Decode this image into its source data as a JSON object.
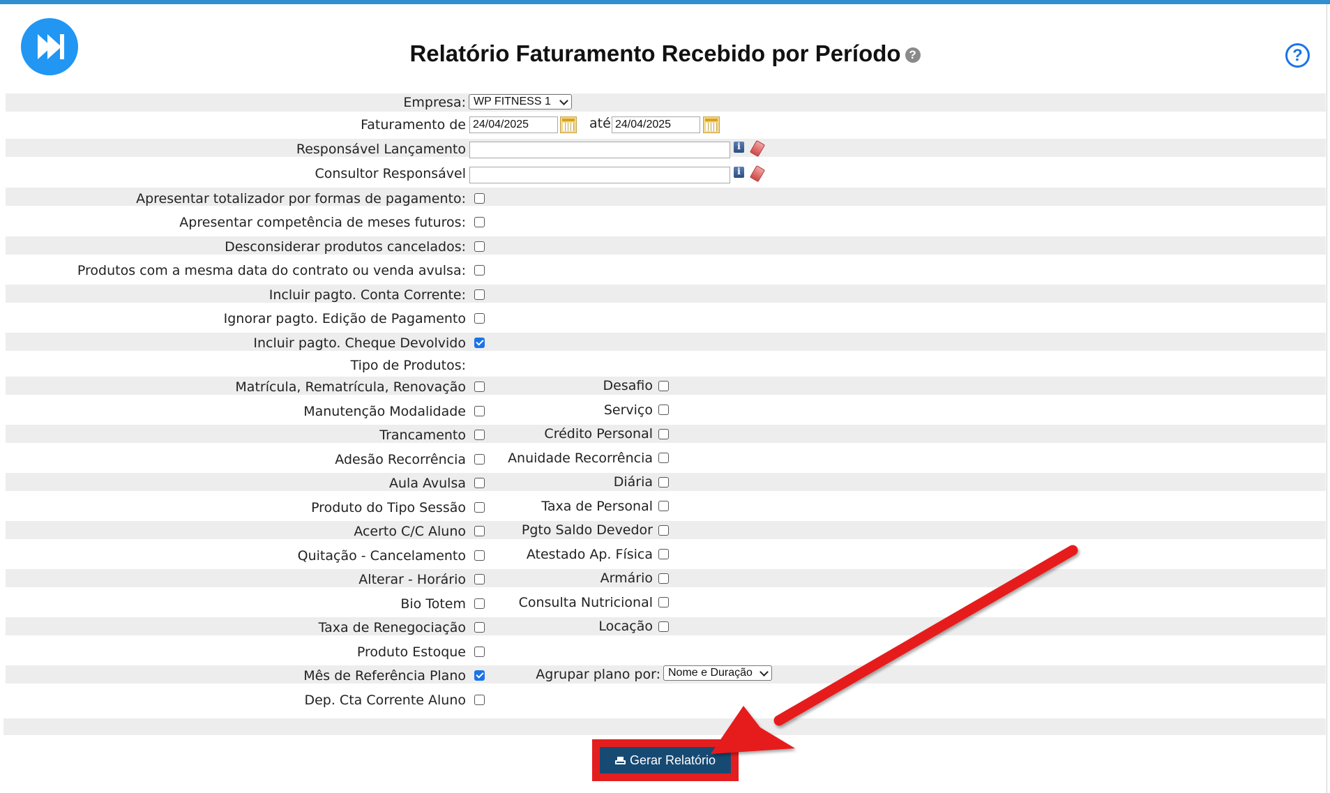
{
  "header": {
    "title": "Relatório Faturamento Recebido por Período",
    "title_help_glyph": "?",
    "help_glyph": "?",
    "logo_icon": "fast-forward-icon"
  },
  "form": {
    "empresa_label": "Empresa:",
    "empresa_value": "WP FITNESS 1",
    "faturamento_label": "Faturamento de",
    "date_from": "24/04/2025",
    "ate_label": "até",
    "date_to": "24/04/2025",
    "responsavel_label": "Responsável Lançamento",
    "consultor_label": "Consultor Responsável",
    "info_glyph": "i"
  },
  "options": [
    {
      "label": "Apresentar totalizador por formas de pagamento:",
      "checked": false
    },
    {
      "label": "Apresentar competência de meses futuros:",
      "checked": false
    },
    {
      "label": "Desconsiderar produtos cancelados:",
      "checked": false
    },
    {
      "label": "Produtos com a mesma data do contrato ou venda avulsa:",
      "checked": false
    },
    {
      "label": "Incluir pagto. Conta Corrente:",
      "checked": false
    },
    {
      "label": "Ignorar pagto. Edição de Pagamento",
      "checked": false
    },
    {
      "label": "Incluir pagto. Cheque Devolvido",
      "checked": true
    }
  ],
  "tipo_produtos_label": "Tipo de Produtos:",
  "product_types": [
    {
      "left": "Matrícula, Rematrícula, Renovação",
      "left_checked": false,
      "right": "Desafio",
      "right_checked": false
    },
    {
      "left": "Manutenção Modalidade",
      "left_checked": false,
      "right": "Serviço",
      "right_checked": false
    },
    {
      "left": "Trancamento",
      "left_checked": false,
      "right": "Crédito Personal",
      "right_checked": false
    },
    {
      "left": "Adesão Recorrência",
      "left_checked": false,
      "right": "Anuidade Recorrência",
      "right_checked": false
    },
    {
      "left": "Aula Avulsa",
      "left_checked": false,
      "right": "Diária",
      "right_checked": false
    },
    {
      "left": "Produto do Tipo Sessão",
      "left_checked": false,
      "right": "Taxa de Personal",
      "right_checked": false
    },
    {
      "left": "Acerto C/C Aluno",
      "left_checked": false,
      "right": "Pgto Saldo Devedor",
      "right_checked": false
    },
    {
      "left": "Quitação - Cancelamento",
      "left_checked": false,
      "right": "Atestado Ap. Física",
      "right_checked": false
    },
    {
      "left": "Alterar - Horário",
      "left_checked": false,
      "right": "Armário",
      "right_checked": false
    },
    {
      "left": "Bio Totem",
      "left_checked": false,
      "right": "Consulta Nutricional",
      "right_checked": false
    },
    {
      "left": "Taxa de Renegociação",
      "left_checked": false,
      "right": "Locação",
      "right_checked": false
    },
    {
      "left": "Produto Estoque",
      "left_checked": false
    },
    {
      "left": "Mês de Referência Plano",
      "left_checked": true,
      "right": "Agrupar plano por:",
      "right_select": "Nome e Duração"
    },
    {
      "left": "Dep. Cta Corrente Aluno",
      "left_checked": false
    }
  ],
  "actions": {
    "generate_label": "Gerar Relatório",
    "generate_icon": "printer-icon"
  },
  "annotation": {
    "highlight_color": "#e41e1e"
  }
}
